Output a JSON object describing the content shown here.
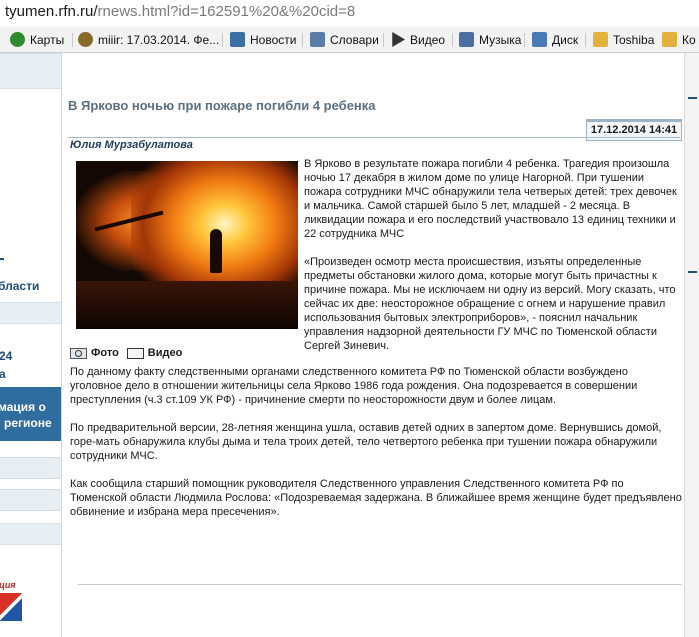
{
  "browser": {
    "url_host": "tyumen.rfn.ru/",
    "url_path": "rnews.html?id=162591%20&%20cid=8",
    "bookmarks": [
      {
        "label": "Карты",
        "icon": "maps-icon",
        "color": "#2e8b2e"
      },
      {
        "label": "miiir: 17.03.2014. Фе...",
        "icon": "blog-icon",
        "color": "#8a6a2a"
      },
      {
        "label": "Новости",
        "icon": "news-icon",
        "color": "#3a6ea5"
      },
      {
        "label": "Словари",
        "icon": "dictionary-icon",
        "color": "#5a7da8"
      },
      {
        "label": "Видео",
        "icon": "video-play-icon",
        "color": "#333333"
      },
      {
        "label": "Музыка",
        "icon": "music-icon",
        "color": "#4a6fa0"
      },
      {
        "label": "Диск",
        "icon": "mail-icon",
        "color": "#4a7ab5"
      },
      {
        "label": "Toshiba",
        "icon": "folder-icon",
        "color": "#e2b23c"
      },
      {
        "label": "Ко",
        "icon": "folder-icon",
        "color": "#e2b23c"
      }
    ]
  },
  "sidebar": {
    "fragments": [
      "бласти",
      "24",
      "а",
      "мация о",
      "регионе",
      "ция"
    ]
  },
  "article": {
    "title": "В Ярково ночью при пожаре погибли 4 ребенка",
    "date": "17.12.2014 14:41",
    "author": "Юлия Мурзабулатова",
    "media_photo_label": "Фото",
    "media_video_label": "Видео",
    "side_paragraphs": [
      "В Ярково в результате пожара погибли 4 ребенка. Трагедия произошла ночью 17 декабря в жилом доме по улице Нагорной. При тушении пожара сотрудники МЧС обнаружили тела четверых детей: трех девочек и мальчика. Самой старшей было 5 лет, младшей - 2 месяца. В ликвидации пожара и его последствий участвовало 13 единиц техники и 22 сотрудника МЧС",
      "«Произведен осмотр места происшествия, изъяты определенные предметы обстановки жилого дома, которые могут быть причастны к причине пожара. Мы не исключаем ни одну из версий. Могу сказать, что сейчас их две: неосторожное обращение с огнем и нарушение правил использования бытовых электроприборов», - пояснил начальник управления надзорной деятельности ГУ МЧС по Тюменской области Сергей Зиневич."
    ],
    "full_paragraphs": [
      "По данному факту следственными органами следственного комитета РФ по Тюменской области возбуждено уголовное дело в отношении жительницы села Ярково 1986 года рождения. Она подозревается в совершении преступления (ч.3 ст.109 УК РФ) - причинение смерти по неосторожности двум и более лицам.",
      "По предварительной версии, 28-летняя женщина ушла, оставив детей одних в запертом доме. Вернувшись домой, горе-мать обнаружила клубы дыма и тела троих детей, тело четвертого ребенка при тушении пожара обнаружили сотрудники МЧС.",
      "Как сообщила старший помощник руководителя Следственного управления Следственного комитета РФ по Тюменской области Людмила Рослова: «Подозреваемая задержана. В ближайшее время женщине будет предъявлено обвинение и избрана мера пресечения»."
    ]
  }
}
